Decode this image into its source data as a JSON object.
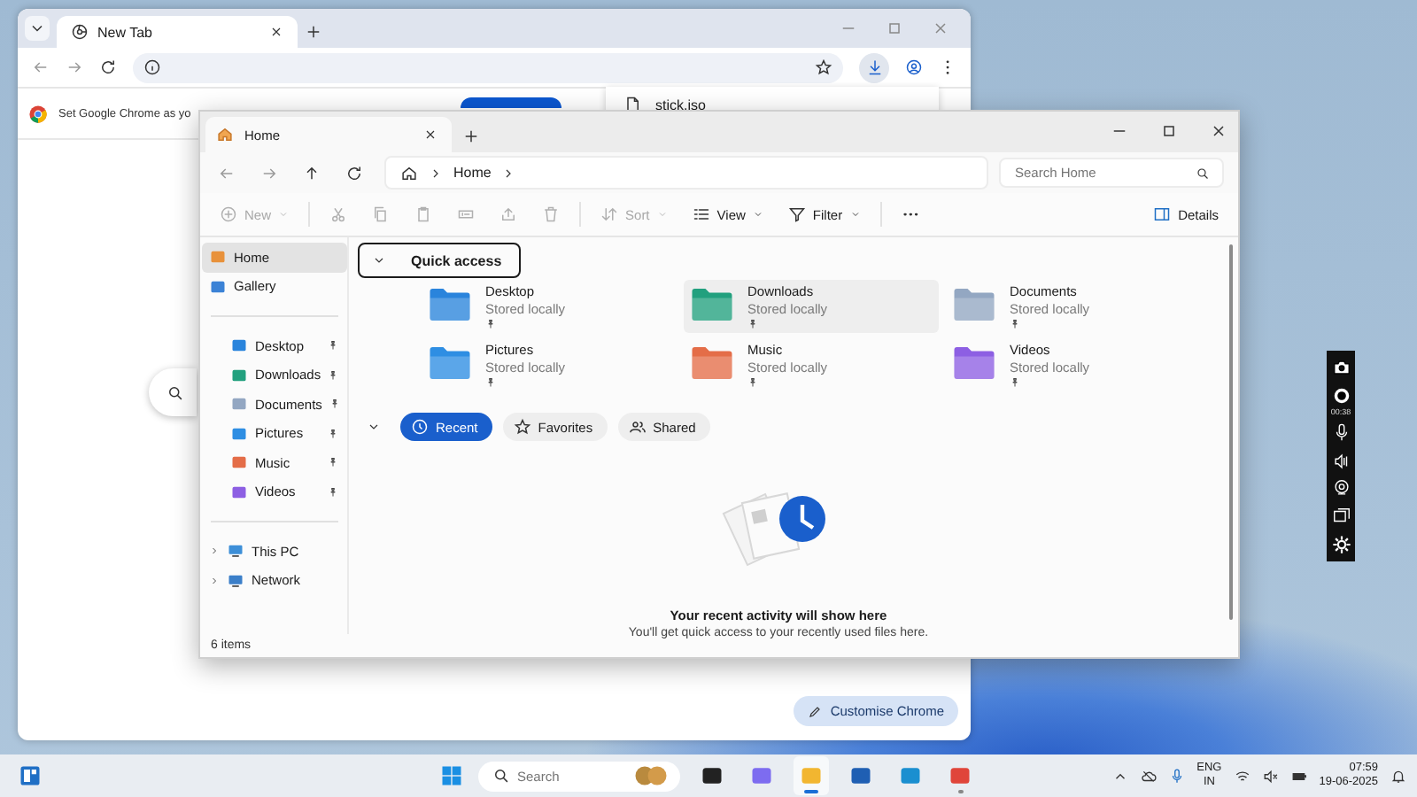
{
  "chrome_window": {
    "tabs": [
      {
        "label": "New Tab",
        "selected": true
      }
    ],
    "banner_text": "Set Google Chrome as yo",
    "download_item": "stick.iso",
    "customise_button": "Customise Chrome"
  },
  "explorer_window": {
    "tabs": [
      {
        "label": "Home",
        "selected": true
      }
    ],
    "breadcrumb": [
      "Home"
    ],
    "search": {
      "placeholder": "Search Home"
    },
    "toolbar": [
      {
        "kind": "new",
        "label": "New",
        "disabled": true
      },
      {
        "kind": "cut",
        "disabled": true
      },
      {
        "kind": "copy",
        "disabled": true
      },
      {
        "kind": "paste",
        "disabled": true
      },
      {
        "kind": "rename",
        "disabled": true
      },
      {
        "kind": "share",
        "disabled": true
      },
      {
        "kind": "delete",
        "disabled": true
      },
      {
        "kind": "sort",
        "label": "Sort",
        "disabled": true
      },
      {
        "kind": "view",
        "label": "View",
        "disabled": false
      },
      {
        "kind": "filter",
        "label": "Filter",
        "disabled": false
      },
      {
        "kind": "more",
        "disabled": false
      }
    ],
    "details_button": "Details",
    "sidebar": {
      "top": [
        {
          "label": "Home",
          "kind": "home",
          "selected": true
        },
        {
          "label": "Gallery",
          "kind": "gallery",
          "selected": false
        }
      ],
      "pinned": [
        {
          "label": "Desktop",
          "kind": "desktop",
          "selected": false,
          "pinned": true
        },
        {
          "label": "Downloads",
          "kind": "downloads",
          "selected": false,
          "pinned": true
        },
        {
          "label": "Documents",
          "kind": "documents",
          "selected": false,
          "pinned": true
        },
        {
          "label": "Pictures",
          "kind": "pictures",
          "selected": false,
          "pinned": true
        },
        {
          "label": "Music",
          "kind": "music",
          "selected": false,
          "pinned": true
        },
        {
          "label": "Videos",
          "kind": "videos",
          "selected": false,
          "pinned": true
        }
      ],
      "locations": [
        {
          "label": "This PC",
          "kind": "pc",
          "selected": false,
          "expanded": false
        },
        {
          "label": "Network",
          "kind": "network",
          "selected": false,
          "expanded": false
        }
      ]
    },
    "quick_access": {
      "title": "Quick access",
      "expanded": true,
      "folders": [
        {
          "name": "Desktop",
          "kind": "desktop",
          "status": "Stored locally",
          "pinned": true,
          "hovered": false
        },
        {
          "name": "Downloads",
          "kind": "downloads",
          "status": "Stored locally",
          "pinned": true,
          "hovered": true
        },
        {
          "name": "Documents",
          "kind": "documents",
          "status": "Stored locally",
          "pinned": true,
          "hovered": false
        },
        {
          "name": "Pictures",
          "kind": "pictures",
          "status": "Stored locally",
          "pinned": true,
          "hovered": false
        },
        {
          "name": "Music",
          "kind": "music",
          "status": "Stored locally",
          "pinned": true,
          "hovered": false
        },
        {
          "name": "Videos",
          "kind": "videos",
          "status": "Stored locally",
          "pinned": true,
          "hovered": false
        }
      ]
    },
    "recent_section": {
      "expanded": true,
      "tabs": [
        {
          "label": "Recent",
          "kind": "recent",
          "selected": true
        },
        {
          "label": "Favorites",
          "kind": "favorites",
          "selected": false
        },
        {
          "label": "Shared",
          "kind": "shared",
          "selected": false
        }
      ]
    },
    "empty_state": {
      "title": "Your recent activity will show here",
      "message": "You'll get quick access to your recently used files here."
    },
    "status_bar": "6 items"
  },
  "recorder_toolbar": {
    "timer": "00:38"
  },
  "taskbar": {
    "apps": [
      {
        "kind": "taskview",
        "selected": false,
        "running": false
      },
      {
        "kind": "copilot",
        "selected": false,
        "running": false
      },
      {
        "kind": "explorer",
        "selected": true,
        "running": true
      },
      {
        "kind": "store",
        "selected": false,
        "running": false
      },
      {
        "kind": "edge",
        "selected": false,
        "running": false
      },
      {
        "kind": "chrome",
        "selected": false,
        "running": true
      }
    ],
    "search_placeholder": "Search",
    "language": "ENG",
    "region": "IN",
    "time": "07:59",
    "date": "19-06-2025"
  }
}
